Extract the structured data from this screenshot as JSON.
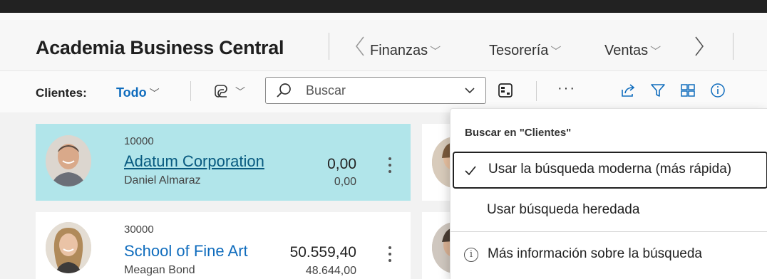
{
  "app": {
    "company": "Academia Business Central"
  },
  "nav": {
    "items": [
      {
        "label": "Finanzas"
      },
      {
        "label": "Tesorería"
      },
      {
        "label": "Ventas"
      }
    ]
  },
  "toolbar": {
    "page_label": "Clientes:",
    "view_label": "Todo",
    "search_placeholder": "Buscar",
    "more_label": "···"
  },
  "customers": [
    {
      "no": "10000",
      "name": "Adatum Corporation",
      "contact": "Daniel Almaraz",
      "balance": "0,00",
      "balance_due": "0,00",
      "selected": true
    },
    {
      "no": "30000",
      "name": "School of Fine Art",
      "contact": "Meagan Bond",
      "balance": "50.559,40",
      "balance_due": "48.644,00",
      "selected": false
    }
  ],
  "search_menu": {
    "header": "Buscar en \"Clientes\"",
    "option_modern": "Usar la búsqueda moderna (más rápida)",
    "option_legacy": "Usar búsqueda heredada",
    "learn_more": "Más información sobre la búsqueda",
    "info_glyph": "i"
  },
  "colors": {
    "accent": "#0f6cbd",
    "selected_card": "#b1e5ea",
    "top_bar": "#222222"
  }
}
